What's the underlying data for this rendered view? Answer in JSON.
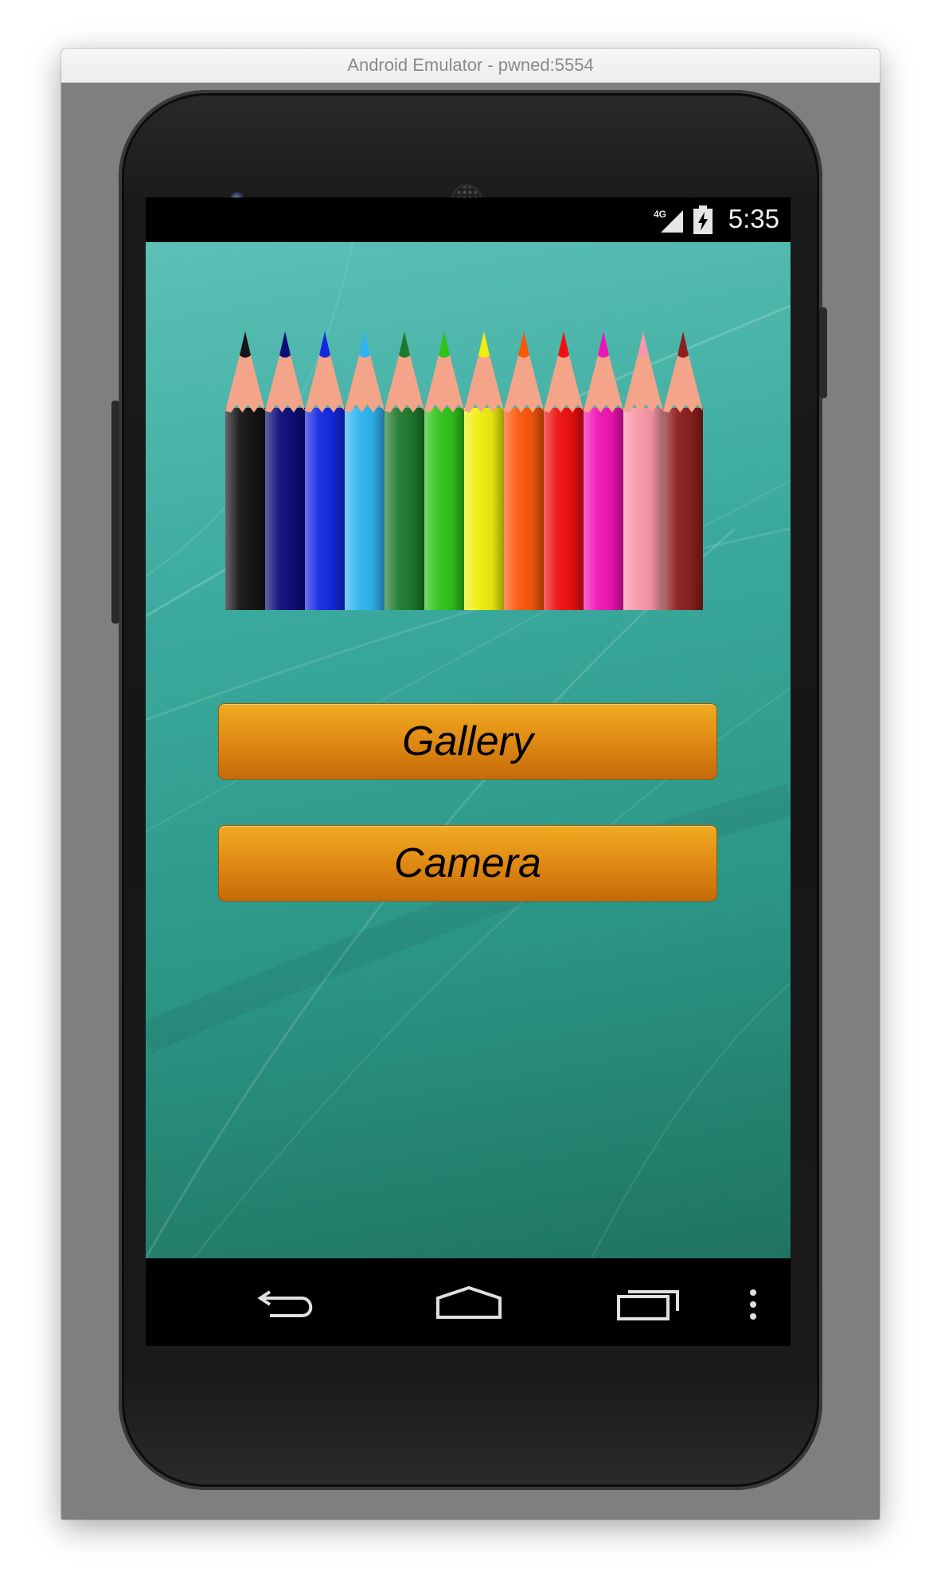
{
  "window": {
    "title": "Android Emulator - pwned:5554"
  },
  "status_bar": {
    "network": "4G",
    "time": "5:35"
  },
  "app": {
    "buttons": {
      "gallery": "Gallery",
      "camera": "Camera"
    },
    "pencil_colors": [
      "#151515",
      "#0d0d7a",
      "#1428e0",
      "#2fb4f0",
      "#1f7a2e",
      "#2fc21b",
      "#efee0e",
      "#f9570a",
      "#ee1010",
      "#ee15b4",
      "#f997a8",
      "#8c1f1f"
    ],
    "pencil_wood_color": "#f3a489",
    "button_color": "#e08a14"
  },
  "nav_bar": {
    "icons": [
      "back-icon",
      "home-icon",
      "recents-icon",
      "overflow-menu-icon"
    ]
  }
}
